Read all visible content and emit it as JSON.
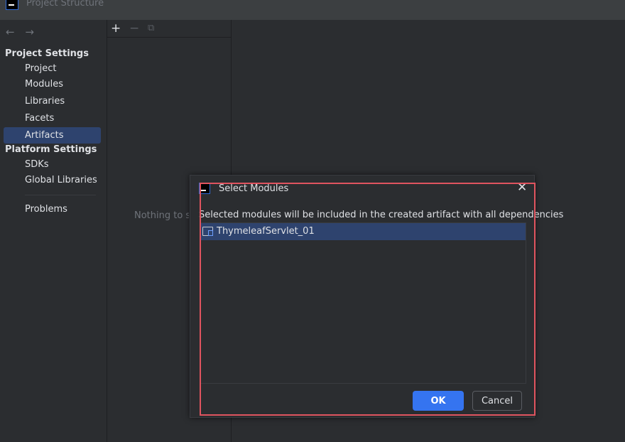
{
  "window": {
    "title": "Project Structure"
  },
  "nav": {
    "back_icon": "←",
    "forward_icon": "→"
  },
  "sidebar": {
    "project_settings_heading": "Project Settings",
    "project_items": [
      {
        "label": "Project"
      },
      {
        "label": "Modules"
      },
      {
        "label": "Libraries"
      },
      {
        "label": "Facets"
      },
      {
        "label": "Artifacts",
        "selected": true
      }
    ],
    "platform_settings_heading": "Platform Settings",
    "platform_items": [
      {
        "label": "SDKs"
      },
      {
        "label": "Global Libraries"
      }
    ],
    "problems_label": "Problems"
  },
  "middle": {
    "add_icon": "+",
    "remove_icon": "−",
    "copy_icon": "⧉",
    "empty_text": "Nothing to show"
  },
  "dialog": {
    "title": "Select Modules",
    "close_icon": "✕",
    "description": "Selected modules will be included in the created artifact with all dependencies",
    "modules": [
      {
        "name": "ThymeleafServlet_01",
        "selected": true
      }
    ],
    "ok_label": "OK",
    "cancel_label": "Cancel"
  },
  "colors": {
    "accent": "#3574f0",
    "selection": "#2e436e",
    "highlight": "#e0545f"
  }
}
